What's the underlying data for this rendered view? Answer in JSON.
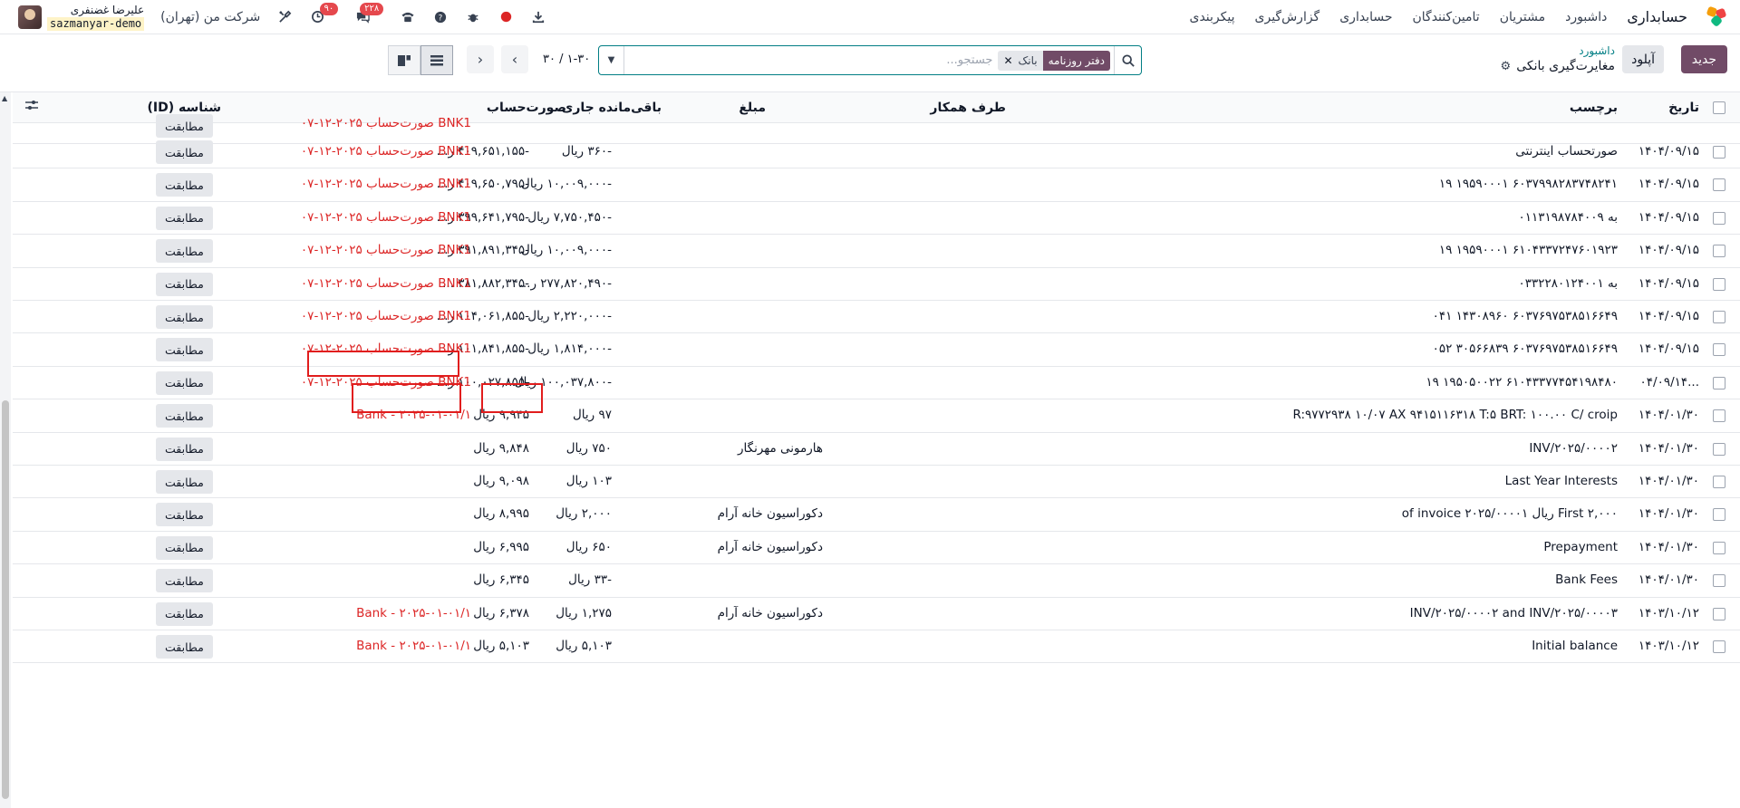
{
  "navbar": {
    "app_name": "حسابداری",
    "menu": [
      "داشبورد",
      "مشتریان",
      "تامین‌کنندگان",
      "حسابداری",
      "گزارش‌گیری",
      "پیکربندی"
    ],
    "messages_badge": "۲۲۸",
    "activity_badge": "۹۰",
    "company": "شرکت من (تهران)",
    "user_name": "علیرضا غضنفری",
    "database": "sazmanyar-demo"
  },
  "control_panel": {
    "new_button": "جدید",
    "upload_button": "آپلود",
    "breadcrumb_parent": "داشبورد",
    "breadcrumb_current": "مغایرت‌گیری بانکی",
    "search_placeholder": "جستجو...",
    "facet_label": "دفتر روزنامه",
    "facet_value": "بانک",
    "pager_value": "۱-۳۰ / ۳۰"
  },
  "table": {
    "headers": {
      "date": "تاریخ",
      "label": "برچسب",
      "partner": "طرف همکار",
      "amount": "مبلغ",
      "running_balance": "باقی‌مانده جاری",
      "statement": "صورت‌حساب",
      "id": "شناسه (ID)"
    },
    "match_label": "مطابقت",
    "partial_top_row": {
      "statement": "BNK1 صورت‌حساب ۲۰۲۵-۱۲-۰۷",
      "button": "مطابقت"
    },
    "rows": [
      {
        "date": "۱۴۰۴/۰۹/۱۵",
        "label": "صورتحساب اینترنتی",
        "partner": "",
        "amount": "-۳۶۰ ریال",
        "balance": "-۴۰۹,۶۵۱,۱۵۵ ر...",
        "statement": "BNK1 صورت‌حساب ۲۰۲۵-۱۲-۰۷"
      },
      {
        "date": "۱۴۰۴/۰۹/۱۵",
        "label": "۶۰۳۷۹۹۸۲۸۳۷۴۸۲۴۱ ۱۹۵۹۰۰۰۱ ۱۹",
        "partner": "",
        "amount": "-۱۰,۰۰۹,۰۰۰ ریال",
        "balance": "-۴۰۹,۶۵۰,۷۹۵ ر...",
        "statement": "BNK1 صورت‌حساب ۲۰۲۵-۱۲-۰۷"
      },
      {
        "date": "۱۴۰۴/۰۹/۱۵",
        "label": "به ۰۱۱۳۱۹۸۷۸۴۰۰۹",
        "partner": "",
        "amount": "-۷,۷۵۰,۴۵۰ ریال",
        "balance": "-۳۹۹,۶۴۱,۷۹۵ ر...",
        "statement": "BNK1 صورت‌حساب ۲۰۲۵-۱۲-۰۷"
      },
      {
        "date": "۱۴۰۴/۰۹/۱۵",
        "label": "۶۱۰۴۳۳۷۲۴۷۶۰۱۹۲۳ ۱۹۵۹۰۰۰۱ ۱۹",
        "partner": "",
        "amount": "-۱۰,۰۰۹,۰۰۰ ریال",
        "balance": "-۳۹۱,۸۹۱,۳۴۵ ر...",
        "statement": "BNK1 صورت‌حساب ۲۰۲۵-۱۲-۰۷"
      },
      {
        "date": "۱۴۰۴/۰۹/۱۵",
        "label": "به ۰۳۳۲۲۸۰۱۲۴۰۰۱",
        "partner": "",
        "amount": "-۲۷۷,۸۲۰,۴۹۰ ر...",
        "balance": "-۳۸۱,۸۸۲,۳۴۵ ...",
        "statement": "BNK1 صورت‌حساب ۲۰۲۵-۱۲-۰۷"
      },
      {
        "date": "۱۴۰۴/۰۹/۱۵",
        "label": "۶۰۳۷۶۹۷۵۳۸۵۱۶۶۴۹ ۱۴۳۰۸۹۶۰ ۰۴۱",
        "partner": "",
        "amount": "-۲,۲۲۰,۰۰۰ ریال",
        "balance": "-۱۰۴,۰۶۱,۸۵۵ ر...",
        "statement": "BNK1 صورت‌حساب ۲۰۲۵-۱۲-۰۷"
      },
      {
        "date": "۱۴۰۴/۰۹/۱۵",
        "label": "۶۰۳۷۶۹۷۵۳۸۵۱۶۶۴۹ ۳۰۵۶۶۸۳۹ ۰۵۲",
        "partner": "",
        "amount": "-۱,۸۱۴,۰۰۰ ریال",
        "balance": "-۱۰۱,۸۴۱,۸۵۵ ر...",
        "statement": "BNK1 صورت‌حساب ۲۰۲۵-۱۲-۰۷"
      },
      {
        "date": "...۰۴/۰۹/۱۴",
        "label": "۶۱۰۴۳۳۷۷۴۵۴۱۹۸۴۸۰ ۱۹۵۰۵۰۰۲۲ ۱۹",
        "partner": "",
        "amount": "-۱۰۰,۰۳۷,۸۰۰ ریال",
        "balance": "-۱۰۰,۰۲۷,۸۵۵ ر...",
        "statement": "BNK1 صورت‌حساب ۲۰۲۵-۱۲-۰۷"
      },
      {
        "date": "۱۴۰۴/۰۱/۳۰",
        "label": "R:۹۷۷۲۹۳۸ ۱۰/۰۷ AX ۹۴۱۵۱۱۶۳۱۸ T:۵ BRT: ۱۰۰.۰۰ C/ croip",
        "partner": "",
        "amount": "۹۷ ریال",
        "balance": "۹,۹۴۵ ریال",
        "statement": "Bank - ۲۰۲۵-۰۱-۰۱/۱"
      },
      {
        "date": "۱۴۰۴/۰۱/۳۰",
        "label": "INV/۲۰۲۵/۰۰۰۰۲",
        "partner": "هارمونی مهرنگار",
        "amount": "۷۵۰ ریال",
        "balance": "۹,۸۴۸ ریال",
        "statement": ""
      },
      {
        "date": "۱۴۰۴/۰۱/۳۰",
        "label": "Last Year Interests",
        "partner": "",
        "amount": "۱۰۳ ریال",
        "balance": "۹,۰۹۸ ریال",
        "statement": ""
      },
      {
        "date": "۱۴۰۴/۰۱/۳۰",
        "label": "First ۲,۰۰۰ ریال of invoice ۲۰۲۵/۰۰۰۰۱",
        "partner": "دکوراسیون خانه آرام",
        "amount": "۲,۰۰۰ ریال",
        "balance": "۸,۹۹۵ ریال",
        "statement": ""
      },
      {
        "date": "۱۴۰۴/۰۱/۳۰",
        "label": "Prepayment",
        "partner": "دکوراسیون خانه آرام",
        "amount": "۶۵۰ ریال",
        "balance": "۶,۹۹۵ ریال",
        "statement": ""
      },
      {
        "date": "۱۴۰۴/۰۱/۳۰",
        "label": "Bank Fees",
        "partner": "",
        "amount": "-۳۳ ریال",
        "balance": "۶,۳۴۵ ریال",
        "statement": ""
      },
      {
        "date": "۱۴۰۳/۱۰/۱۲",
        "label": "INV/۲۰۲۵/۰۰۰۰۲ and INV/۲۰۲۵/۰۰۰۰۳",
        "partner": "دکوراسیون خانه آرام",
        "amount": "۱,۲۷۵ ریال",
        "balance": "۶,۳۷۸ ریال",
        "statement": "Bank - ۲۰۲۵-۰۱-۰۱/۱"
      },
      {
        "date": "۱۴۰۳/۱۰/۱۲",
        "label": "Initial balance",
        "partner": "",
        "amount": "۵,۱۰۳ ریال",
        "balance": "۵,۱۰۳ ریال",
        "statement": "Bank - ۲۰۲۵-۰۱-۰۱/۱"
      }
    ]
  }
}
